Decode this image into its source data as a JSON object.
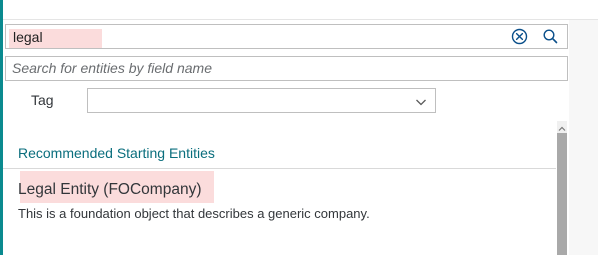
{
  "search": {
    "value": "legal",
    "clear_icon": "clear-circle-icon",
    "search_icon": "search-icon"
  },
  "field_search": {
    "placeholder": "Search for entities by field name",
    "value": ""
  },
  "tag": {
    "label": "Tag",
    "selected": "",
    "dropdown_icon": "chevron-down-icon"
  },
  "results": {
    "section_title": "Recommended Starting Entities",
    "items": [
      {
        "title": "Legal Entity (FOCompany)",
        "description": "This is a foundation object that describes a generic company."
      }
    ]
  },
  "colors": {
    "accent": "#0a8a8f",
    "section_title": "#0a6e7d",
    "highlight": "#fbdcdc"
  }
}
